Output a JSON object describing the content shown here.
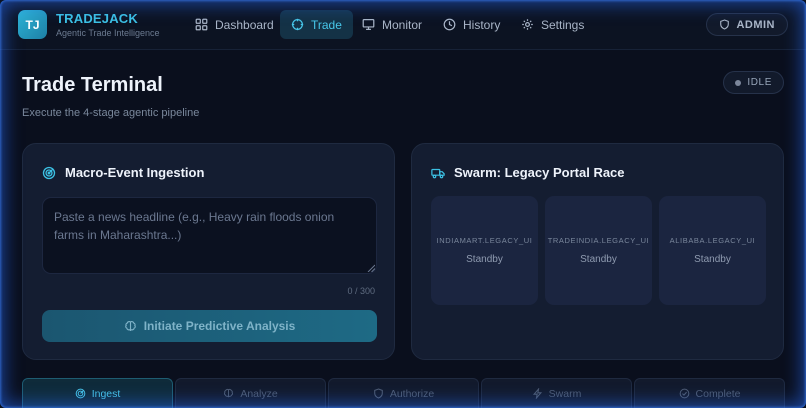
{
  "brand": {
    "badge": "TJ",
    "title": "TRADEJACK",
    "subtitle": "Agentic Trade Intelligence"
  },
  "nav": {
    "items": [
      {
        "label": "Dashboard",
        "icon": "grid-icon",
        "active": false
      },
      {
        "label": "Trade",
        "icon": "crosshair-icon",
        "active": true
      },
      {
        "label": "Monitor",
        "icon": "monitor-icon",
        "active": false
      },
      {
        "label": "History",
        "icon": "clock-icon",
        "active": false
      },
      {
        "label": "Settings",
        "icon": "gear-icon",
        "active": false
      }
    ],
    "admin_label": "ADMIN"
  },
  "page": {
    "title": "Trade Terminal",
    "subtitle": "Execute the 4-stage agentic pipeline",
    "status": "IDLE"
  },
  "ingestion": {
    "title": "Macro-Event Ingestion",
    "placeholder": "Paste a news headline (e.g., Heavy rain floods onion farms in Maharashtra...)",
    "value": "",
    "char_count": "0 / 300",
    "button_label": "Initiate Predictive Analysis"
  },
  "swarm": {
    "title": "Swarm: Legacy Portal Race",
    "portals": [
      {
        "name": "INDIAMART.LEGACY_UI",
        "status": "Standby"
      },
      {
        "name": "TRADEINDIA.LEGACY_UI",
        "status": "Standby"
      },
      {
        "name": "ALIBABA.LEGACY_UI",
        "status": "Standby"
      }
    ]
  },
  "steps": [
    {
      "label": "Ingest",
      "active": true
    },
    {
      "label": "Analyze",
      "active": false
    },
    {
      "label": "Authorize",
      "active": false
    },
    {
      "label": "Swarm",
      "active": false
    },
    {
      "label": "Complete",
      "active": false
    }
  ],
  "colors": {
    "accent": "#3cc1e4",
    "background": "#0a0f1d",
    "card": "#141d31",
    "glow": "#286eff"
  }
}
